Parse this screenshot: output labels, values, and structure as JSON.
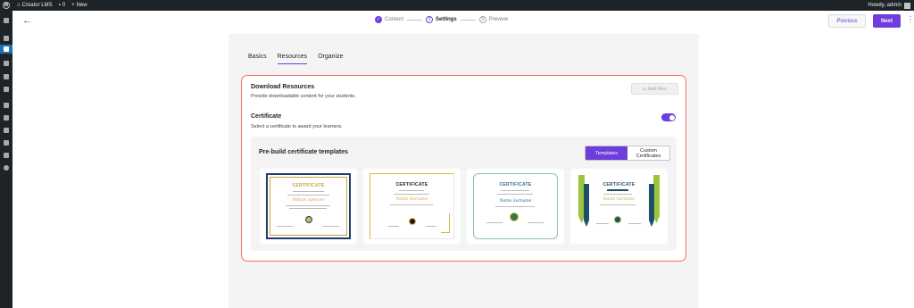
{
  "admin_bar": {
    "site_name": "Creator LMS",
    "comments_count": "0",
    "new_label": "New",
    "greeting": "Howdy, admin"
  },
  "wizard": {
    "steps": [
      {
        "number": "✓",
        "label": "Content",
        "state": "done"
      },
      {
        "number": "2",
        "label": "Settings",
        "state": "current"
      },
      {
        "number": "3",
        "label": "Preview",
        "state": "upcoming"
      }
    ],
    "previous_label": "Previous",
    "next_label": "Next"
  },
  "tabs": [
    {
      "label": "Basics",
      "active": false
    },
    {
      "label": "Resources",
      "active": true
    },
    {
      "label": "Organize",
      "active": false
    }
  ],
  "download_resources": {
    "title": "Download Resources",
    "description": "Provide downloadable content for your students.",
    "add_files_label": "Add files"
  },
  "certificate": {
    "title": "Certificate",
    "description": "Select a certificate to award your learners.",
    "enabled": true
  },
  "templates": {
    "title": "Pre-build certificate templates",
    "toggle_templates": "Templates",
    "toggle_custom": "Custom Certificates",
    "items": [
      {
        "heading": "CERTIFICATE",
        "name": "Willam Spencer"
      },
      {
        "heading": "CERTIFICATE",
        "name": "Name Surname"
      },
      {
        "heading": "CERTIFICATE",
        "name": "Name Surname"
      },
      {
        "heading": "CERTIFICATE",
        "name": "Name Surname"
      }
    ]
  },
  "colors": {
    "accent": "#6e3ddb",
    "highlight_border": "#f07167",
    "wp_bar": "#1d2327"
  }
}
